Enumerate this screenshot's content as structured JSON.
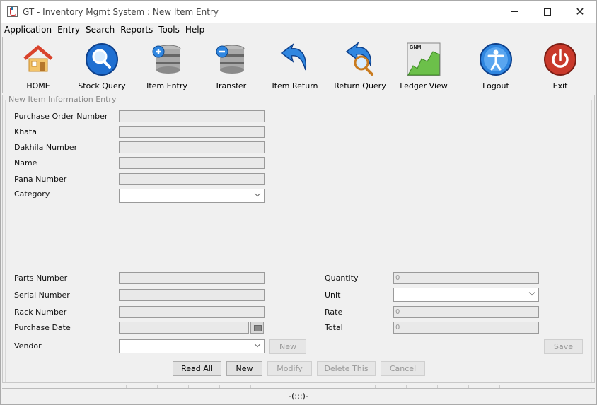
{
  "window": {
    "title": "GT - Inventory Mgmt System : New Item Entry"
  },
  "menu": [
    "Application",
    "Entry",
    "Search",
    "Reports",
    "Tools",
    "Help"
  ],
  "toolbar": [
    {
      "label": "HOME",
      "icon": "home-icon"
    },
    {
      "label": "Stock Query",
      "icon": "magnifier-icon"
    },
    {
      "label": "Item Entry",
      "icon": "database-add-icon"
    },
    {
      "label": "Transfer",
      "icon": "database-remove-icon"
    },
    {
      "label": "Item Return",
      "icon": "return-arrow-icon"
    },
    {
      "label": "Return Query",
      "icon": "return-search-icon"
    },
    {
      "label": "Ledger View",
      "icon": "ledger-chart-icon",
      "badge": "GNM"
    },
    {
      "label": "Logout",
      "icon": "person-icon"
    },
    {
      "label": "Exit",
      "icon": "power-icon"
    }
  ],
  "form": {
    "legend": "New Item Information Entry",
    "labels": {
      "po_number": "Purchase Order Number",
      "khata": "Khata",
      "dakhila": "Dakhila Number",
      "name": "Name",
      "pana": "Pana Number",
      "category": "Category",
      "parts": "Parts Number",
      "serial": "Serial Number",
      "rack": "Rack Number",
      "purchase_date": "Purchase Date",
      "vendor": "Vendor",
      "quantity": "Quantity",
      "unit": "Unit",
      "rate": "Rate",
      "total": "Total"
    },
    "values": {
      "quantity": "0",
      "rate": "0",
      "total": "0"
    },
    "vendor_new_label": "New",
    "save_label": "Save"
  },
  "actions": [
    "Read All",
    "New",
    "Modify",
    "Delete This",
    "Cancel"
  ],
  "status": "-(:::)-",
  "colors": {
    "background": "#f0f0f0",
    "field_disabled": "#e9e9e9",
    "accent_blue": "#1f6fd1"
  }
}
